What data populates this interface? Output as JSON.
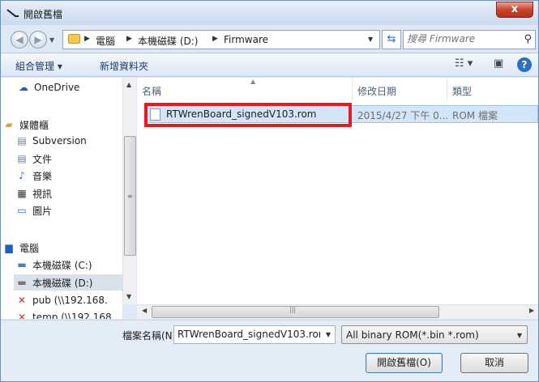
{
  "window": {
    "title": "開啟舊檔",
    "close_glyph": "x"
  },
  "address": {
    "breadcrumbs": [
      "電腦",
      "本機磁碟 (D:)",
      "Firmware"
    ],
    "search_placeholder": "搜尋 Firmware"
  },
  "toolbar": {
    "organize_label": "組合管理 ▾",
    "new_folder_label": "新增資料夾"
  },
  "nav": {
    "items": [
      {
        "label": "OneDrive",
        "icon": "cloud-icon"
      },
      {
        "label": "媒體櫃",
        "icon": "library-icon"
      },
      {
        "label": "Subversion",
        "icon": "document-icon"
      },
      {
        "label": "文件",
        "icon": "document-icon"
      },
      {
        "label": "音樂",
        "icon": "music-icon"
      },
      {
        "label": "視訊",
        "icon": "video-icon"
      },
      {
        "label": "圖片",
        "icon": "picture-icon"
      },
      {
        "label": "電腦",
        "icon": "computer-icon"
      },
      {
        "label": "本機磁碟 (C:)",
        "icon": "drive-icon"
      },
      {
        "label": "本機磁碟 (D:)",
        "icon": "drive-icon"
      },
      {
        "label": "pub (\\\\192.168.",
        "icon": "network-drive-icon"
      },
      {
        "label": "temp (\\\\192.168",
        "icon": "network-drive-icon"
      }
    ],
    "selected_index": 9
  },
  "columns": {
    "name": "名稱",
    "modified": "修改日期",
    "type": "類型"
  },
  "files": [
    {
      "name": "RTWrenBoard_signedV103.rom",
      "modified": "2015/4/27 下午 0...",
      "type": "ROM 檔案"
    }
  ],
  "bottom": {
    "filename_label": "檔案名稱(N):",
    "filename_value": "RTWrenBoard_signedV103.rom",
    "filetype_value": "All binary ROM(*.bin *.rom)",
    "open_label": "開啟舊檔(O)",
    "cancel_label": "取消"
  },
  "colors": {
    "highlight": "#e41b23",
    "selection": "#d3e5f8",
    "accent": "#2b6fc7"
  }
}
